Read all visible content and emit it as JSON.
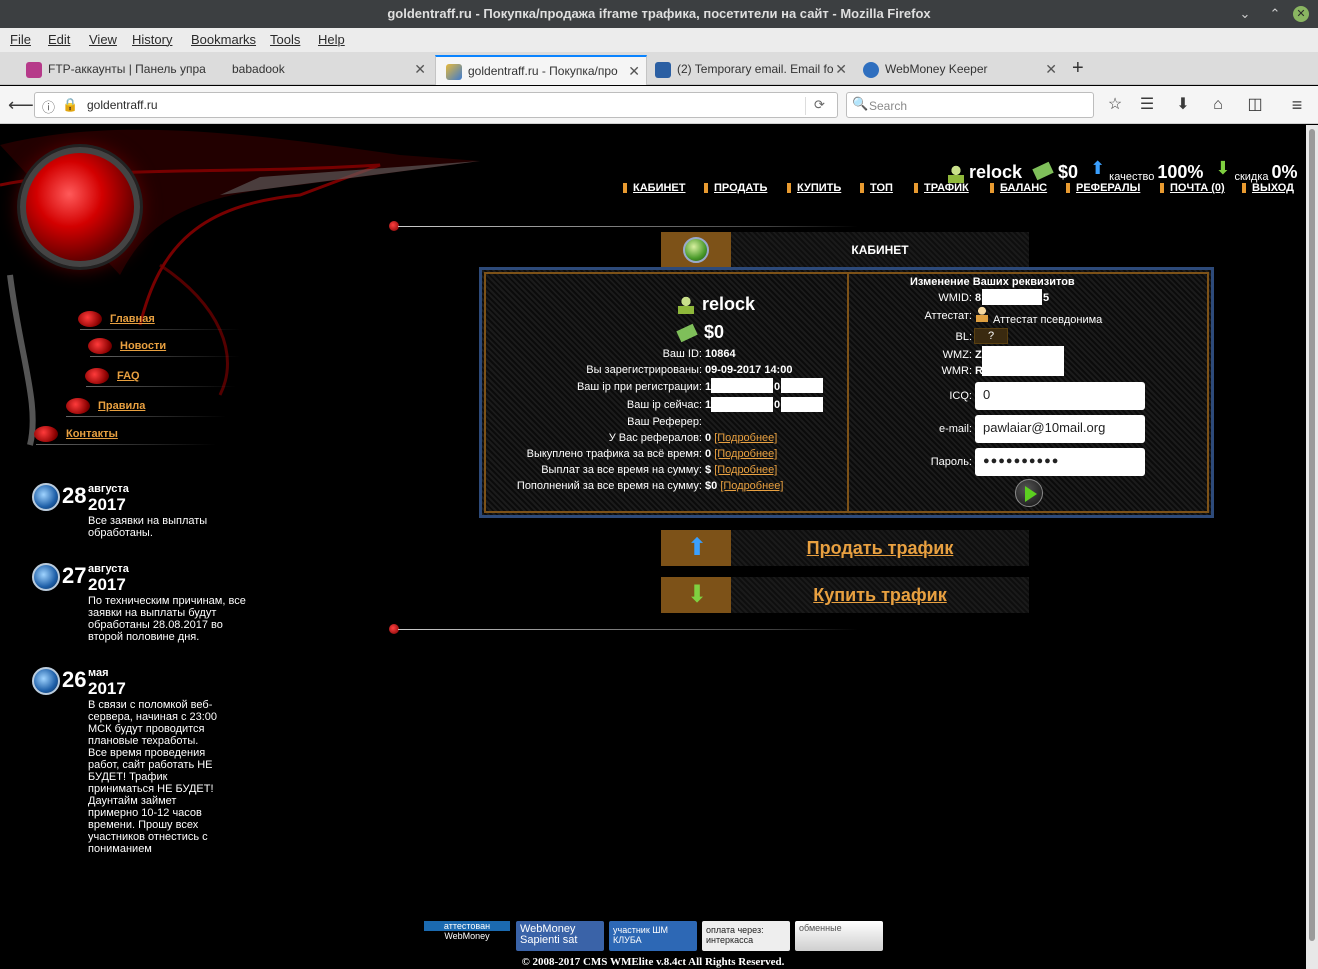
{
  "window": {
    "title": "goldentraff.ru - Покупка/продажа iframe трафика, посетители на сайт - Mozilla Firefox"
  },
  "menubar": [
    "File",
    "Edit",
    "View",
    "History",
    "Bookmarks",
    "Tools",
    "Help"
  ],
  "tabs": [
    {
      "label": "FTP-аккаунты | Панель упра",
      "icon": "ftp-icon"
    },
    {
      "label": "babadook",
      "icon": ""
    },
    {
      "label": "goldentraff.ru - Покупка/про",
      "icon": "goldentraff-icon"
    },
    {
      "label": "(2) Temporary email. Email fo",
      "icon": "mail-icon"
    },
    {
      "label": "WebMoney Keeper",
      "icon": "globe-icon"
    }
  ],
  "url": "goldentraff.ru",
  "search_placeholder": "Search",
  "leftnav": [
    "Главная",
    "Новости",
    "FAQ",
    "Правила",
    "Контакты"
  ],
  "news": [
    {
      "day": "28",
      "month": "августа",
      "year": "2017",
      "text": "Все заявки на выплаты обработаны."
    },
    {
      "day": "27",
      "month": "августа",
      "year": "2017",
      "text": "По техническим причинам, все заявки на выплаты будут обработаны 28.08.2017 во второй половине дня."
    },
    {
      "day": "26",
      "month": "мая",
      "year": "2017",
      "text": "В связи с поломкой веб-сервера, начиная с 23:00 МСК будут проводится плановые техработы. Все время проведения работ, сайт работать НЕ БУДЕТ! Трафик приниматься НЕ БУДЕТ! Даунтайм займет примерно 10-12 часов времени. Прошу всех участников отнестись с пониманием"
    }
  ],
  "topbar": {
    "username": "relock",
    "balance": "$0",
    "quality_label": "качество",
    "quality_value": "100%",
    "discount_label": "скидка",
    "discount_value": "0%"
  },
  "topmenu": [
    "КАБИНЕТ",
    "ПРОДАТЬ",
    "КУПИТЬ",
    "ТОП",
    "ТРАФИК",
    "БАЛАНС",
    "РЕФЕРАЛЫ",
    "ПОЧТА (0)",
    "ВЫХОД"
  ],
  "cabinet": {
    "header": "КАБИНЕТ",
    "username": "relock",
    "balance": "$0",
    "rows": [
      {
        "label": "Ваш ID:",
        "value": "10864",
        "link": ""
      },
      {
        "label": "Вы зарегистрированы:",
        "value": "09-09-2017 14:00",
        "link": ""
      },
      {
        "label": "Ваш ip при регистрации:",
        "value": "1",
        "link": ""
      },
      {
        "label": "Ваш ip сейчас:",
        "value": "1",
        "link": ""
      },
      {
        "label": "Ваш Реферер:",
        "value": "",
        "link": ""
      },
      {
        "label": "У Вас рефералов:",
        "value": "0",
        "link": "[Подробнее]"
      },
      {
        "label": "Выкуплено трафика за всё время:",
        "value": "0",
        "link": "[Подробнее]"
      },
      {
        "label": "Выплат за все время на сумму:",
        "value": "$",
        "link": "[Подробнее]"
      },
      {
        "label": "Пополнений за все время на сумму:",
        "value": "$0",
        "link": "[Подробнее]"
      }
    ],
    "ip_reg_suffix": "0",
    "ip_now_suffix": "0",
    "right": {
      "title": "Изменение Ваших реквизитов",
      "wmid_label": "WMID:",
      "wmid_prefix": "8",
      "wmid_suffix": "5",
      "attestat_label": "Аттестат:",
      "attestat_value": "Аттестат псевдонима",
      "bl_label": "BL:",
      "bl_value": "?",
      "wmz_label": "WMZ:",
      "wmz_prefix": "Z",
      "wmr_label": "WMR:",
      "wmr_prefix": "R",
      "icq_label": "ICQ:",
      "icq_value": "0",
      "email_label": "e-mail:",
      "email_value": "pawlaiar@10mail.org",
      "password_label": "Пароль:",
      "password_value": "●●●●●●●●●●"
    }
  },
  "actions": {
    "sell": "Продать трафик",
    "buy": "Купить трафик"
  },
  "footer": {
    "badges": [
      "аттестован WebMoney",
      "WebMoney Sapienti sat",
      "участник ШМ КЛУБА",
      "оплата через: интеркасса",
      "обменные"
    ],
    "copyright": "© 2008-2017 CMS WMElite v.8.4ct All Rights Reserved."
  }
}
